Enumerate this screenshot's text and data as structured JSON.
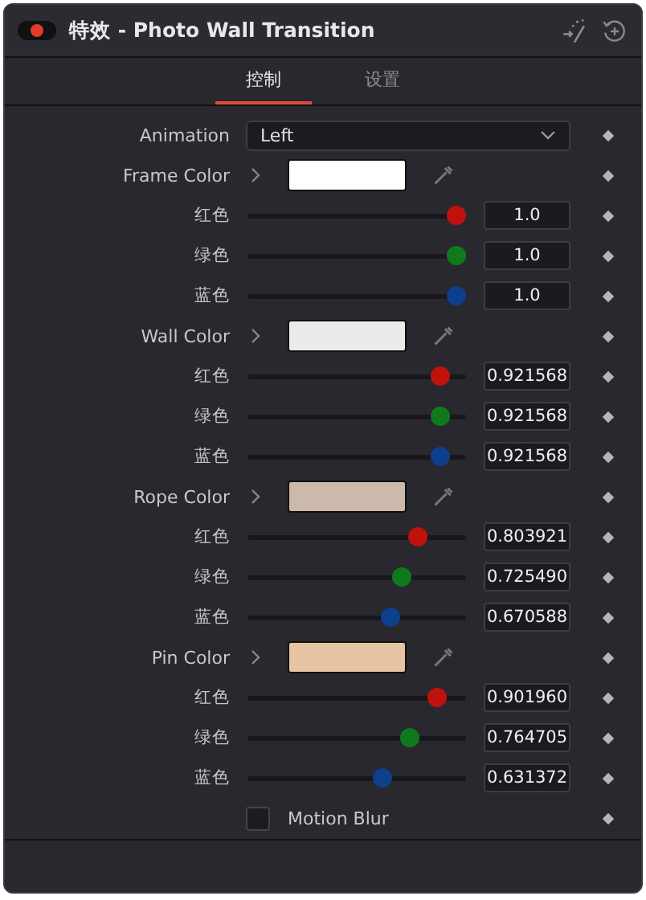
{
  "header": {
    "title": "特效 - Photo Wall Transition",
    "enabled": true
  },
  "tabs": [
    {
      "label": "控制",
      "selected": true
    },
    {
      "label": "设置",
      "selected": false
    }
  ],
  "rows": [
    {
      "kind": "dropdown",
      "label": "Animation",
      "value": "Left"
    },
    {
      "kind": "color",
      "label": "Frame Color",
      "color": "#ffffff"
    },
    {
      "kind": "channel",
      "label": "红色",
      "color": "#c0120c",
      "level": 1.0,
      "value": "1.0"
    },
    {
      "kind": "channel",
      "label": "绿色",
      "color": "#0f7a1c",
      "level": 1.0,
      "value": "1.0"
    },
    {
      "kind": "channel",
      "label": "蓝色",
      "color": "#0d3f8a",
      "level": 1.0,
      "value": "1.0"
    },
    {
      "kind": "color",
      "label": "Wall Color",
      "color": "#ebebeb"
    },
    {
      "kind": "channel",
      "label": "红色",
      "color": "#c0120c",
      "level": 0.921568,
      "value": "0.921568"
    },
    {
      "kind": "channel",
      "label": "绿色",
      "color": "#0f7a1c",
      "level": 0.921568,
      "value": "0.921568"
    },
    {
      "kind": "channel",
      "label": "蓝色",
      "color": "#0d3f8a",
      "level": 0.921568,
      "value": "0.921568"
    },
    {
      "kind": "color",
      "label": "Rope Color",
      "color": "#cdb9ab"
    },
    {
      "kind": "channel",
      "label": "红色",
      "color": "#c0120c",
      "level": 0.803921,
      "value": "0.803921"
    },
    {
      "kind": "channel",
      "label": "绿色",
      "color": "#0f7a1c",
      "level": 0.72549,
      "value": "0.725490"
    },
    {
      "kind": "channel",
      "label": "蓝色",
      "color": "#0d3f8a",
      "level": 0.670588,
      "value": "0.670588"
    },
    {
      "kind": "color",
      "label": "Pin Color",
      "color": "#e6c3a1"
    },
    {
      "kind": "channel",
      "label": "红色",
      "color": "#c0120c",
      "level": 0.90196,
      "value": "0.901960"
    },
    {
      "kind": "channel",
      "label": "绿色",
      "color": "#0f7a1c",
      "level": 0.764705,
      "value": "0.764705"
    },
    {
      "kind": "channel",
      "label": "蓝色",
      "color": "#0d3f8a",
      "level": 0.631372,
      "value": "0.631372"
    },
    {
      "kind": "checkbox",
      "label": "Motion Blur",
      "checked": false
    }
  ]
}
